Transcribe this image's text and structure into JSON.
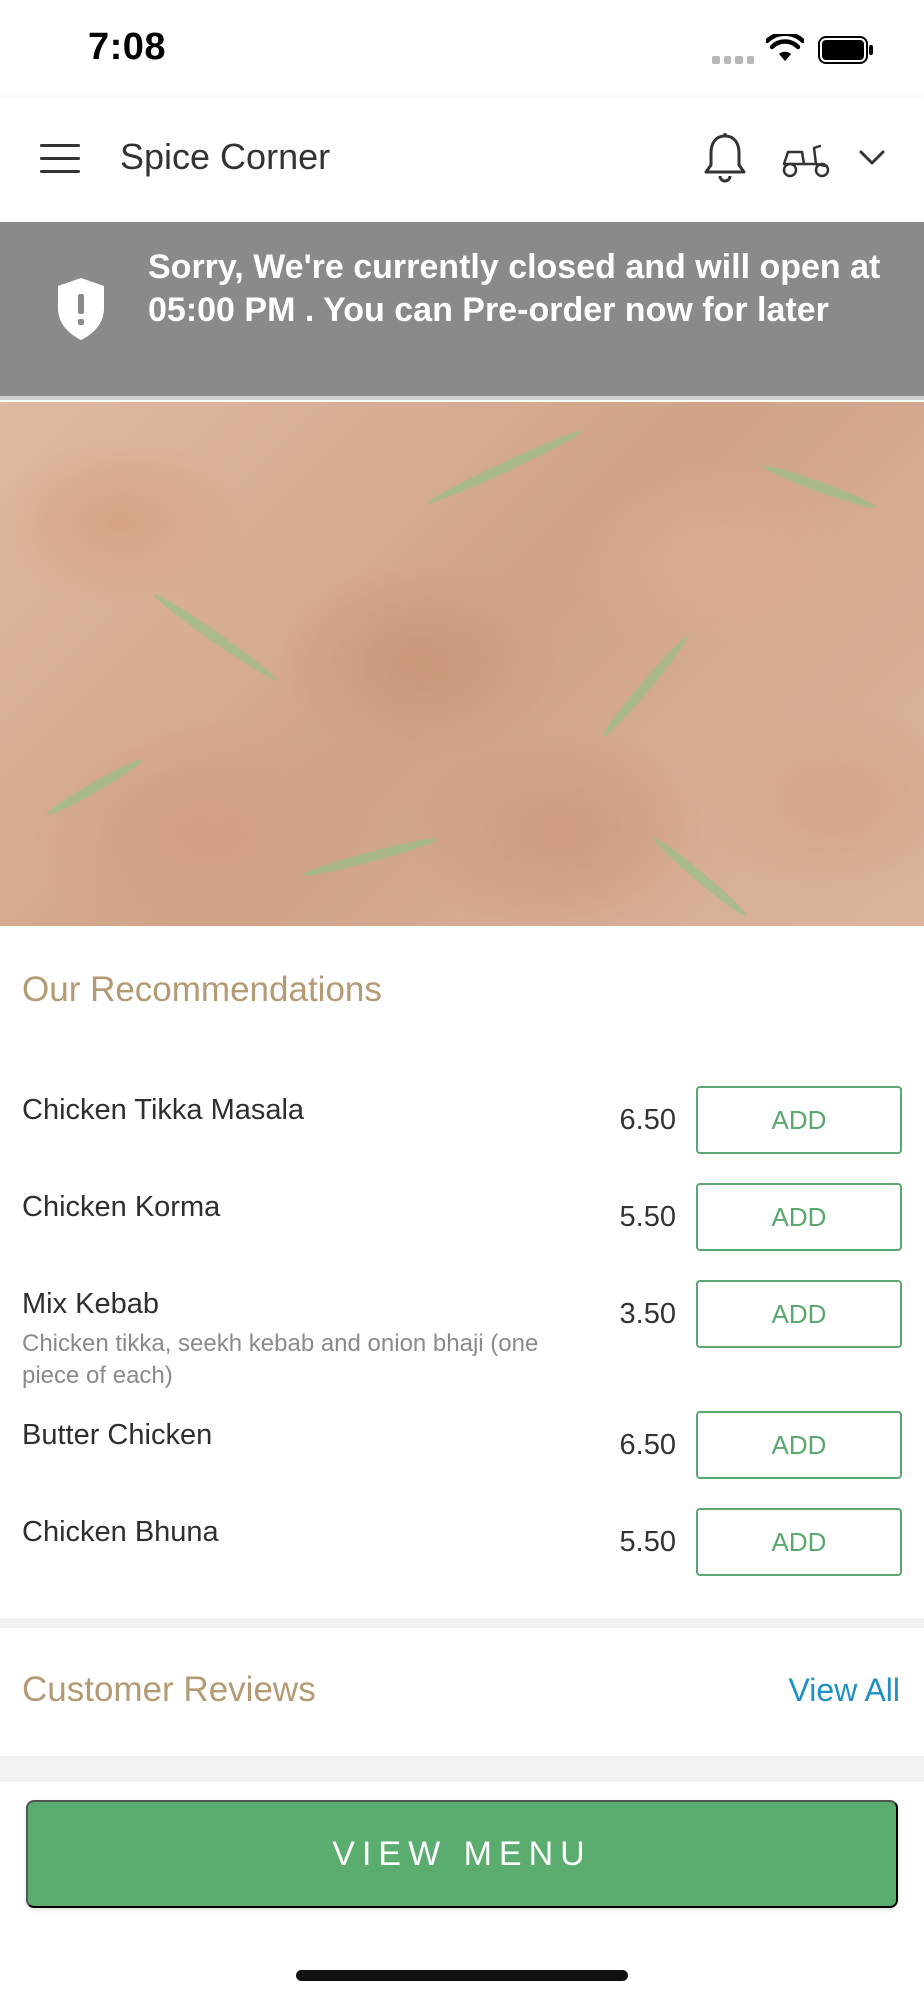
{
  "status_bar": {
    "time": "7:08"
  },
  "header": {
    "title": "Spice Corner",
    "icons": [
      "hamburger-menu-icon",
      "bell-icon",
      "scooter-icon",
      "chevron-down-icon"
    ]
  },
  "banner": {
    "message": "Sorry, We're currently closed and will open at 05:00 PM . You can Pre-order now for later",
    "icon": "shield-alert-icon"
  },
  "recommendations": {
    "title": "Our Recommendations",
    "items": [
      {
        "name": "Chicken Tikka Masala",
        "description": "",
        "price": "6.50",
        "button": "ADD"
      },
      {
        "name": "Chicken Korma",
        "description": "",
        "price": "5.50",
        "button": "ADD"
      },
      {
        "name": "Mix Kebab",
        "description": "Chicken tikka, seekh kebab and onion bhaji (one piece of each)",
        "price": "3.50",
        "button": "ADD"
      },
      {
        "name": "Butter Chicken",
        "description": "",
        "price": "6.50",
        "button": "ADD"
      },
      {
        "name": "Chicken Bhuna",
        "description": "",
        "price": "5.50",
        "button": "ADD"
      }
    ]
  },
  "reviews": {
    "title": "Customer Reviews",
    "view_all": "View All"
  },
  "footer": {
    "view_menu": "VIEW MENU"
  },
  "colors": {
    "accent_green": "#5aad6e",
    "section_title": "#b39a72",
    "link_blue": "#1f8fc5",
    "banner_gray": "#8a8a8a"
  }
}
